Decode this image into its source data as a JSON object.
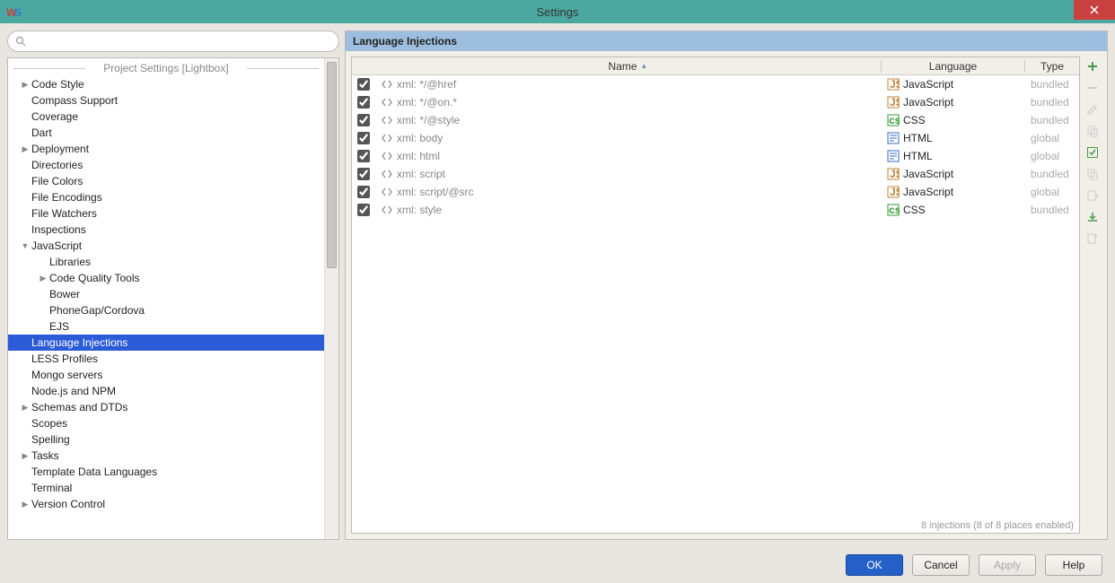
{
  "window": {
    "title": "Settings"
  },
  "search": {
    "placeholder": ""
  },
  "sidebar": {
    "section_header": "Project Settings [Lightbox]",
    "items": [
      {
        "label": "Code Style",
        "level": 0,
        "arrow": "▶"
      },
      {
        "label": "Compass Support",
        "level": 0,
        "arrow": ""
      },
      {
        "label": "Coverage",
        "level": 0,
        "arrow": ""
      },
      {
        "label": "Dart",
        "level": 0,
        "arrow": ""
      },
      {
        "label": "Deployment",
        "level": 0,
        "arrow": "▶"
      },
      {
        "label": "Directories",
        "level": 0,
        "arrow": ""
      },
      {
        "label": "File Colors",
        "level": 0,
        "arrow": ""
      },
      {
        "label": "File Encodings",
        "level": 0,
        "arrow": ""
      },
      {
        "label": "File Watchers",
        "level": 0,
        "arrow": ""
      },
      {
        "label": "Inspections",
        "level": 0,
        "arrow": ""
      },
      {
        "label": "JavaScript",
        "level": 0,
        "arrow": "▼"
      },
      {
        "label": "Libraries",
        "level": 1,
        "arrow": ""
      },
      {
        "label": "Code Quality Tools",
        "level": 1,
        "arrow": "▶"
      },
      {
        "label": "Bower",
        "level": 1,
        "arrow": ""
      },
      {
        "label": "PhoneGap/Cordova",
        "level": 1,
        "arrow": ""
      },
      {
        "label": "EJS",
        "level": 1,
        "arrow": ""
      },
      {
        "label": "Language Injections",
        "level": 0,
        "arrow": "",
        "selected": true
      },
      {
        "label": "LESS Profiles",
        "level": 0,
        "arrow": ""
      },
      {
        "label": "Mongo servers",
        "level": 0,
        "arrow": ""
      },
      {
        "label": "Node.js and NPM",
        "level": 0,
        "arrow": ""
      },
      {
        "label": "Schemas and DTDs",
        "level": 0,
        "arrow": "▶"
      },
      {
        "label": "Scopes",
        "level": 0,
        "arrow": ""
      },
      {
        "label": "Spelling",
        "level": 0,
        "arrow": ""
      },
      {
        "label": "Tasks",
        "level": 0,
        "arrow": "▶"
      },
      {
        "label": "Template Data Languages",
        "level": 0,
        "arrow": ""
      },
      {
        "label": "Terminal",
        "level": 0,
        "arrow": ""
      },
      {
        "label": "Version Control",
        "level": 0,
        "arrow": "▶"
      }
    ]
  },
  "panel": {
    "title": "Language Injections"
  },
  "table": {
    "headers": {
      "name": "Name",
      "language": "Language",
      "type": "Type"
    },
    "rows": [
      {
        "checked": true,
        "name": "xml: */@href",
        "lang": "JavaScript",
        "lang_icon": "js",
        "type": "bundled"
      },
      {
        "checked": true,
        "name": "xml: */@on.*",
        "lang": "JavaScript",
        "lang_icon": "js",
        "type": "bundled"
      },
      {
        "checked": true,
        "name": "xml: */@style",
        "lang": "CSS",
        "lang_icon": "css",
        "type": "bundled"
      },
      {
        "checked": true,
        "name": "xml: body",
        "lang": "HTML",
        "lang_icon": "html",
        "type": "global"
      },
      {
        "checked": true,
        "name": "xml: html",
        "lang": "HTML",
        "lang_icon": "html",
        "type": "global"
      },
      {
        "checked": true,
        "name": "xml: script",
        "lang": "JavaScript",
        "lang_icon": "js",
        "type": "bundled"
      },
      {
        "checked": true,
        "name": "xml: script/@src",
        "lang": "JavaScript",
        "lang_icon": "js",
        "type": "global"
      },
      {
        "checked": true,
        "name": "xml: style",
        "lang": "CSS",
        "lang_icon": "css",
        "type": "bundled"
      }
    ],
    "status": "8 injections (8 of 8 places enabled)"
  },
  "footer": {
    "ok": "OK",
    "cancel": "Cancel",
    "apply": "Apply",
    "help": "Help"
  }
}
